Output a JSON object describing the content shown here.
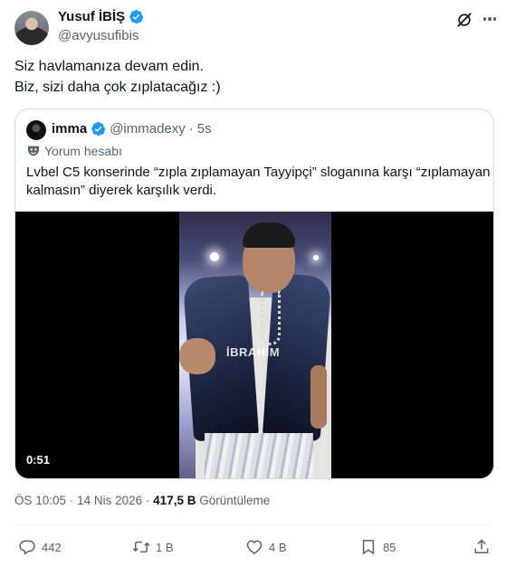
{
  "author": {
    "display_name": "Yusuf İBİŞ",
    "handle": "@avyusufibis"
  },
  "tweet": {
    "lines": [
      "Siz havlamanıza devam edin.",
      "Biz, sizi daha çok zıplatacağız :)"
    ]
  },
  "quote": {
    "display_name": "imma",
    "handle": "@immadexy",
    "separator": "·",
    "time": "5s",
    "badge_label": "Yorum hesabı",
    "lines": [
      "Lvbel C5 konserinde “zıpla zıplamayan Tayyipçi” sloganına karşı “zıplamayan",
      "kalmasın” diyerek karşılık verdi."
    ],
    "video": {
      "duration": "0:51",
      "watermark": "İBRAHİM"
    }
  },
  "meta": {
    "time": "ÖS 10:05",
    "dot": "·",
    "date": "14 Nis 2026",
    "views_count": "417,5 B",
    "views_label": "Görüntüleme"
  },
  "actions": {
    "replies": "442",
    "reposts": "1 B",
    "likes": "4 B",
    "bookmarks": "85"
  },
  "colors": {
    "verified": "#1d9bf0",
    "text": "#0f1419",
    "secondary": "#536471",
    "border": "#cfd9de"
  },
  "icons": [
    "verified-badge-icon",
    "grok-icon",
    "more-icon",
    "mask-icon",
    "reply-icon",
    "repost-icon",
    "like-icon",
    "bookmark-icon",
    "share-icon"
  ]
}
